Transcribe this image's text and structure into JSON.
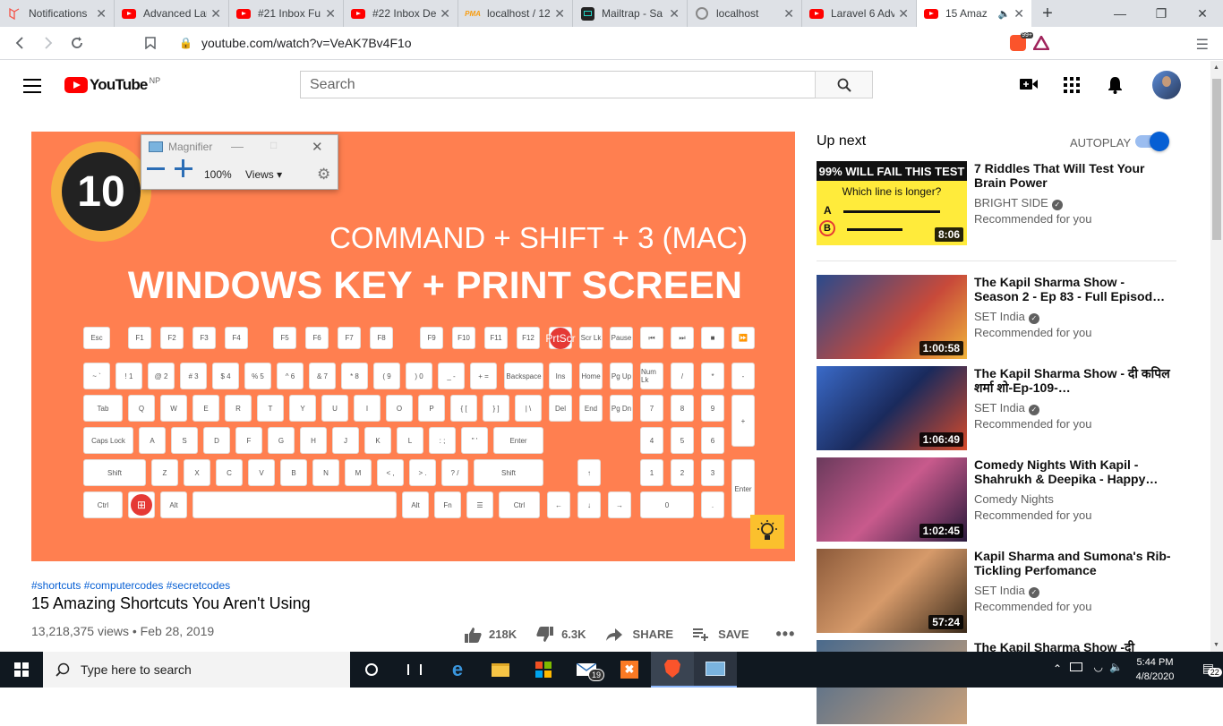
{
  "browser": {
    "tabs": [
      {
        "title": "Notifications",
        "icon": "laravel-icon",
        "active": false
      },
      {
        "title": "Advanced Lar",
        "icon": "youtube-icon",
        "active": false
      },
      {
        "title": "#21 Inbox Fu",
        "icon": "youtube-icon",
        "active": false
      },
      {
        "title": "#22 Inbox De",
        "icon": "youtube-icon",
        "active": false
      },
      {
        "title": "localhost / 12",
        "icon": "phpmyadmin-icon",
        "active": false
      },
      {
        "title": "Mailtrap - Sa",
        "icon": "mailtrap-icon",
        "active": false
      },
      {
        "title": "localhost",
        "icon": "globe-icon",
        "active": false
      },
      {
        "title": "Laravel 6 Adv",
        "icon": "youtube-icon",
        "active": false
      },
      {
        "title": "15 Amaz",
        "icon": "youtube-icon",
        "active": true
      }
    ],
    "url": "youtube.com/watch?v=VeAK7Bv4F1o",
    "brave_badge": "99+"
  },
  "youtube": {
    "logo_text": "YouTube",
    "region": "NP",
    "search_placeholder": "Search"
  },
  "video": {
    "big_number": "10",
    "line1": "COMMAND + SHIFT + 3 (MAC)",
    "line2": "WINDOWS KEY + PRINT SCREEN",
    "hashtags": "#shortcuts #computercodes #secretcodes",
    "title": "15 Amazing Shortcuts You Aren't Using",
    "meta": "13,218,375 views • Feb 28, 2019",
    "likes": "218K",
    "dislikes": "6.3K",
    "share_label": "SHARE",
    "save_label": "SAVE"
  },
  "magnifier": {
    "title": "Magnifier",
    "zoom": "100%",
    "views_label": "Views"
  },
  "up_next": {
    "heading": "Up next",
    "autoplay_label": "AUTOPLAY",
    "autoplay_on": true,
    "items": [
      {
        "title": "7 Riddles That Will Test Your Brain Power",
        "channel": "BRIGHT SIDE",
        "sub": "Recommended for you",
        "duration": "8:06",
        "thumb_text1": "99% WILL FAIL THIS TEST",
        "thumb_text2": "Which line is longer?"
      },
      {
        "title": "The Kapil Sharma Show - Season 2 - Ep 83 - Full Episod…",
        "channel": "SET India",
        "sub": "Recommended for you",
        "duration": "1:00:58"
      },
      {
        "title": "The Kapil Sharma Show - दी कपिल शर्मा शो-Ep-109-…",
        "channel": "SET India",
        "sub": "Recommended for you",
        "duration": "1:06:49"
      },
      {
        "title": "Comedy Nights With Kapil - Shahrukh & Deepika - Happy…",
        "channel": "Comedy Nights",
        "sub": "Recommended for you",
        "duration": "1:02:45"
      },
      {
        "title": "Kapil Sharma and Sumona's Rib-Tickling Perfomance",
        "channel": "SET India",
        "sub": "Recommended for you",
        "duration": "57:24"
      },
      {
        "title": "The Kapil Sharma Show -दी",
        "channel": "",
        "sub": "",
        "duration": ""
      }
    ]
  },
  "taskbar": {
    "search_placeholder": "Type here to search",
    "time": "5:44 PM",
    "date": "4/8/2020",
    "mail_badge": "19",
    "notif_badge": "22"
  }
}
